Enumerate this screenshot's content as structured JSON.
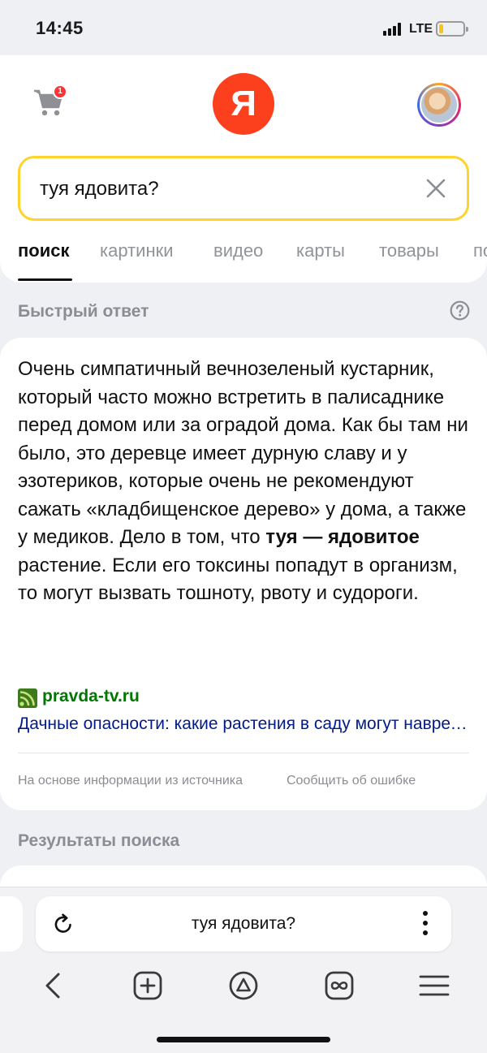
{
  "status_bar": {
    "time": "14:45",
    "network": "LTE"
  },
  "header": {
    "cart_badge": "1",
    "logo_letter": "Я",
    "search_query": "туя ядовита?"
  },
  "tabs": [
    "поиск",
    "картинки",
    "видео",
    "карты",
    "товары",
    "по"
  ],
  "quick_answer": {
    "title": "Быстрый ответ",
    "text_before": "Очень симпатичный вечнозеленый кустарник, который часто можно встретить в палисаднике перед домом или за оградой дома. Как бы там ни было, это деревце имеет дурную славу и у эзотериков, которые очень не рекомендуют сажать «кладбищенское дерево» у дома, а также у медиков. Дело в том, что ",
    "text_bold": "туя — ядовитое",
    "text_after": " растение. Если его токсины попадут в организм, то могут вызвать тошноту, рвоту и судороги.",
    "source_name": "pravda-tv.ru",
    "source_link": "Дачные опасности: какие растения в саду могут навредить",
    "footer_left": "На основе информации из источника",
    "footer_right": "Сообщить об ошибке"
  },
  "results_title": "Результаты поиска",
  "browser_bar": {
    "address_text": "туя ядовита?"
  },
  "colors": {
    "yandex_red": "#fc3f1d",
    "search_border": "#fed42b",
    "source_green": "#007700",
    "link_blue": "#001a8a",
    "badge_red": "#ff3333"
  }
}
